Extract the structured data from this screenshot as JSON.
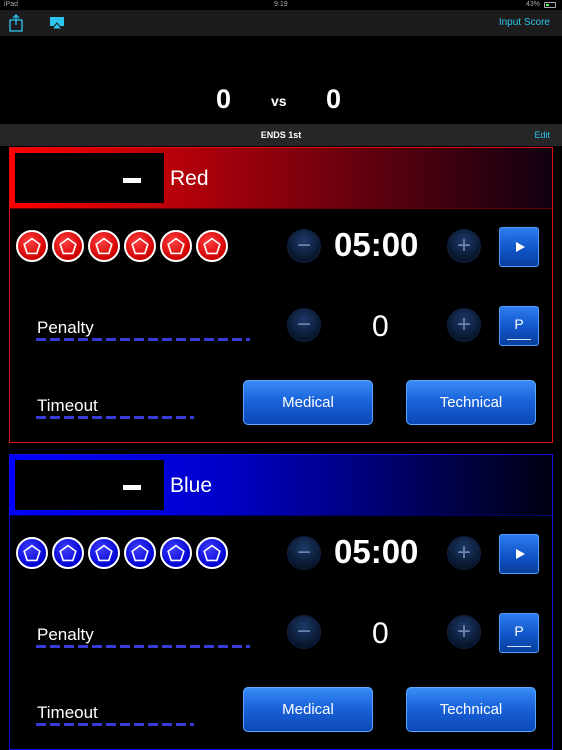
{
  "status_bar": {
    "device": "iPad",
    "time": "9:19",
    "battery": "43%"
  },
  "nav": {
    "input_score": "Input Score"
  },
  "score": {
    "left": "0",
    "vs": "vs",
    "right": "0"
  },
  "ends": {
    "label": "ENDS 1st",
    "edit": "Edit"
  },
  "players": [
    {
      "color": "#e01010",
      "name": "Red",
      "timer": "05:00",
      "penalty_label": "Penalty",
      "penalty_value": "0",
      "timeout_label": "Timeout",
      "medical_label": "Medical",
      "technical_label": "Technical",
      "p_label": "P",
      "pentagon_count": 6
    },
    {
      "color": "#1010e0",
      "name": "Blue",
      "timer": "05:00",
      "penalty_label": "Penalty",
      "penalty_value": "0",
      "timeout_label": "Timeout",
      "medical_label": "Medical",
      "technical_label": "Technical",
      "p_label": "P",
      "pentagon_count": 6
    }
  ],
  "icons": {
    "share": "share-icon",
    "airplay": "airplay-icon",
    "minus": "minus-icon",
    "plus": "plus-icon",
    "play": "play-icon",
    "pentagon": "pentagon-icon"
  },
  "colors": {
    "accent": "#2ec5f0",
    "red": "#ff0000",
    "blue": "#0000ff",
    "button": "#1a63db"
  }
}
